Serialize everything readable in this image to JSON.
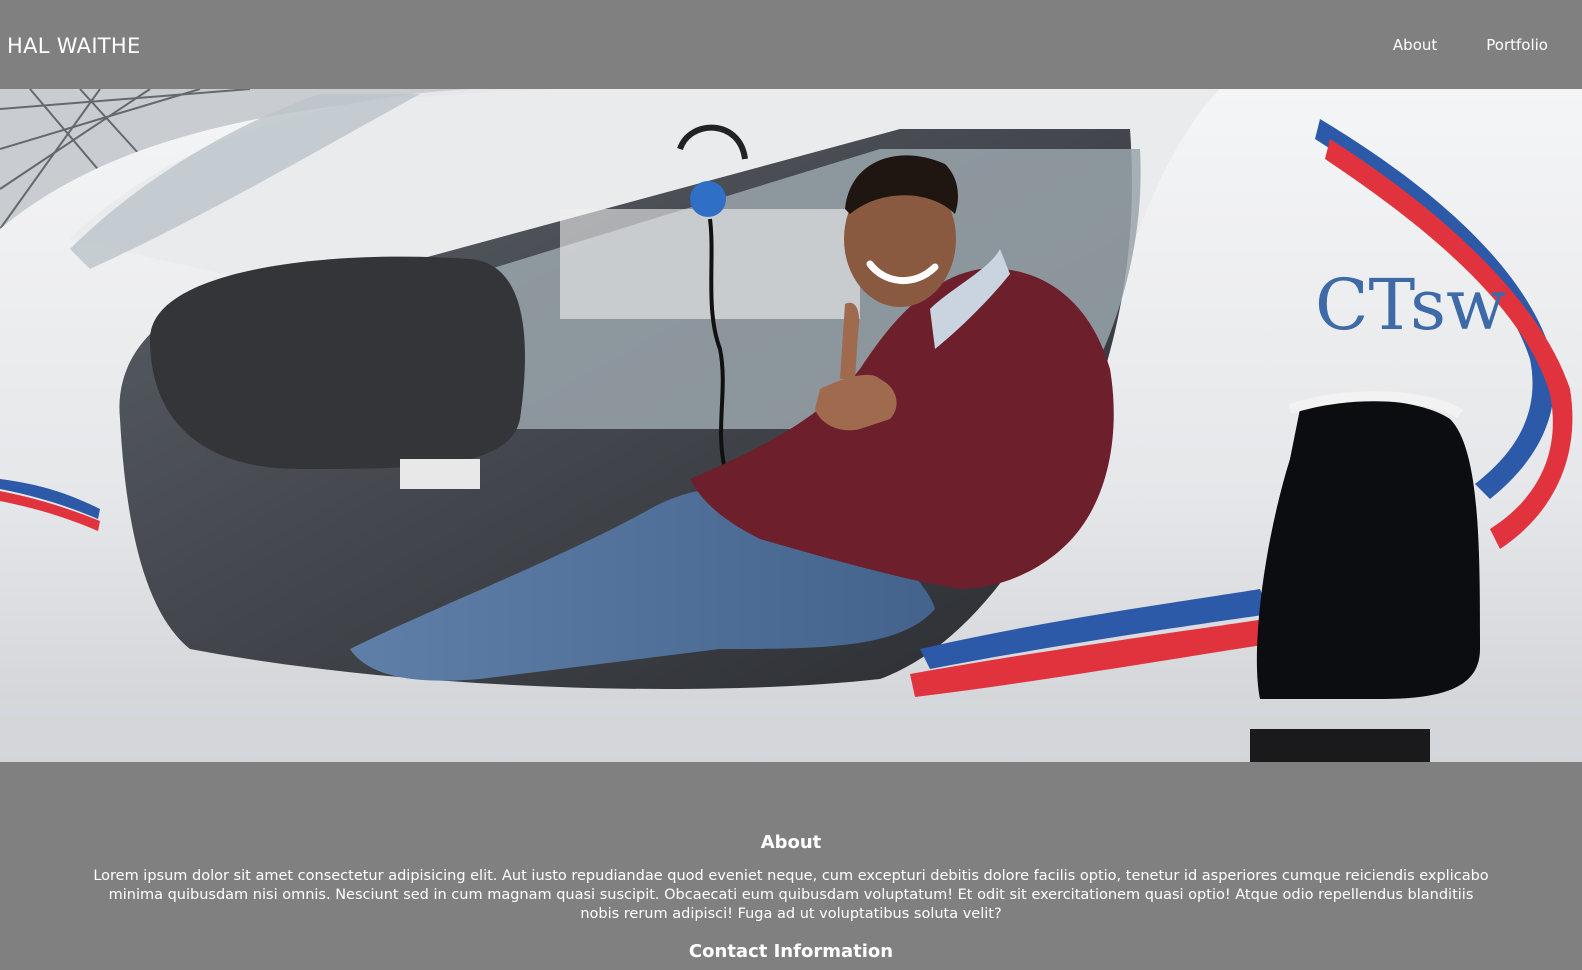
{
  "header": {
    "brand": "HAL WAITHE",
    "nav": [
      {
        "label": "About"
      },
      {
        "label": "Portfolio"
      }
    ]
  },
  "hero": {
    "fuselage_text": "CTsw"
  },
  "about": {
    "heading": "About",
    "body": "Lorem ipsum dolor sit amet consectetur adipisicing elit. Aut iusto repudiandae quod eveniet neque, cum excepturi debitis dolore facilis optio, tenetur id asperiores cumque reiciendis explicabo minima quibusdam nisi omnis. Nesciunt sed in cum magnam quasi suscipit. Obcaecati eum quibusdam voluptatum! Et odit sit exercitationem quasi optio! Atque odio repellendus blanditiis nobis rerum adipisci! Fuga ad ut voluptatibus soluta velit?",
    "contact_heading": "Contact Information"
  },
  "colors": {
    "page_background": "#808080",
    "text": "#ffffff",
    "stripe_blue": "#2c5aa8",
    "stripe_red": "#e0333d",
    "sweater": "#6e1f2c"
  }
}
